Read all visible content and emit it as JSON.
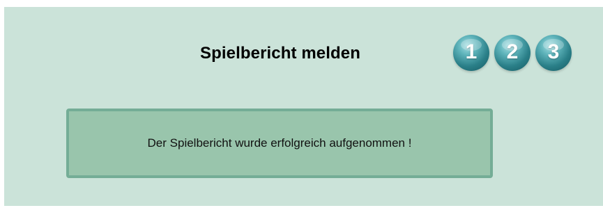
{
  "page": {
    "title": "Spielbericht melden"
  },
  "steps": [
    {
      "label": "1"
    },
    {
      "label": "2"
    },
    {
      "label": "3"
    }
  ],
  "message": {
    "text": "Der Spielbericht wurde erfolgreich aufgenommen !"
  },
  "colors": {
    "panel_background": "#cbe3d9",
    "message_background": "#99c5ac",
    "message_border": "#74ad96",
    "step_teal": "#2a7f88"
  }
}
